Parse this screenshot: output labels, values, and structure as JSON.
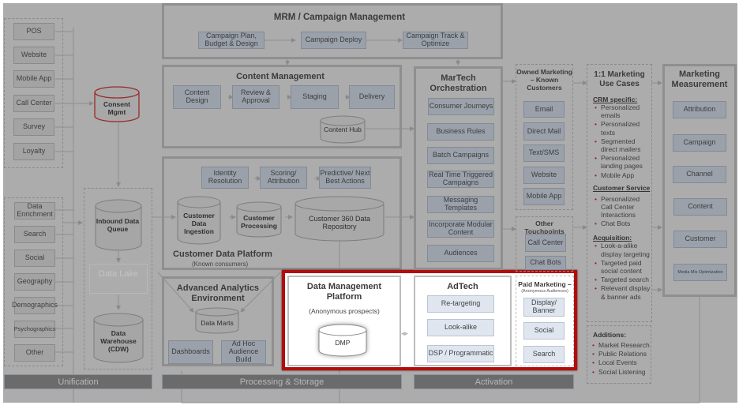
{
  "sources": {
    "first_party": [
      "POS",
      "Website",
      "Mobile App",
      "Call Center",
      "Survey",
      "Loyalty"
    ],
    "third_party": [
      "Data Enrichment",
      "Search",
      "Social",
      "Geography",
      "Demographics",
      "Psychographics",
      "Other"
    ]
  },
  "unification": {
    "consent": "Consent Mgmt",
    "inbound_queue": "Inbound Data Queue",
    "data_lake": "Data Lake",
    "warehouse": "Data Warehouse (CDW)",
    "band": "Unification"
  },
  "mrm": {
    "title": "MRM / Campaign Management",
    "steps": [
      "Campaign Plan, Budget & Design",
      "Campaign Deploy",
      "Campaign Track & Optimize"
    ]
  },
  "content_mgmt": {
    "title": "Content Management",
    "steps": [
      "Content Design",
      "Review & Approval",
      "Staging",
      "Delivery"
    ],
    "hub": "Content Hub"
  },
  "cdp": {
    "title": "Customer Data Platform",
    "subtitle": "(Known consumers)",
    "steps": [
      "Identity Resolution",
      "Scoring/ Attribution",
      "Predictive/ Next Best Actions"
    ],
    "ingestion": "Customer Data Ingestion",
    "processing": "Customer Processing",
    "repo": "Customer 360 Data Repository"
  },
  "analytics": {
    "title": "Advanced Analytics Environment",
    "marts": "Data Marts",
    "dashboards": "Dashboards",
    "adhoc": "Ad Hoc Audience Build"
  },
  "processing_band": "Processing & Storage",
  "dmp": {
    "title": "Data Management Platform",
    "subtitle": "(Anonymous prospects)",
    "db": "DMP"
  },
  "adtech": {
    "title": "AdTech",
    "items": [
      "Re-targeting",
      "Look-alike",
      "DSP / Programmatic"
    ]
  },
  "paid": {
    "title": "Paid Marketing –",
    "subtitle": "(Anonymous Audiences)",
    "items": [
      "Display/ Banner",
      "Social",
      "Search"
    ]
  },
  "martech": {
    "title": "MarTech Orchestration",
    "items": [
      "Consumer Journeys",
      "Business Rules",
      "Batch Campaigns",
      "Real Time Triggered Campaigns",
      "Messaging Templates",
      "Incorporate Modular Content",
      "Audiences"
    ]
  },
  "owned": {
    "title": "Owned Marketing – Known Customers",
    "items": [
      "Email",
      "Direct Mail",
      "Text/SMS",
      "Website",
      "Mobile App"
    ]
  },
  "other_touch": {
    "title": "Other Touchpoints",
    "items": [
      "Call Center",
      "Chat Bots"
    ]
  },
  "activation_band": "Activation",
  "use_cases": {
    "title": "1:1 Marketing Use Cases",
    "crm_head": "CRM specific:",
    "crm": [
      "Personalized emails",
      "Personalized texts",
      "Segmented direct mailers",
      "Personalized landing pages",
      "Mobile App"
    ],
    "cs_head": "Customer Service",
    "cs": [
      "Personalized Call Center Interactions",
      "Chat Bots"
    ],
    "acq_head": "Acquisition:",
    "acq": [
      "Look-a-alike display targeting",
      "Targeted paid social content",
      "Targeted search",
      "Relevant display & banner ads"
    ]
  },
  "additions": {
    "title": "Additions:",
    "items": [
      "Market Research",
      "Public Relations",
      "Local Events",
      "Social Listening"
    ]
  },
  "measurement": {
    "title": "Marketing Measurement",
    "items": [
      "Attribution",
      "Campaign",
      "Channel",
      "Content",
      "Customer",
      "Media Mix Optimization"
    ]
  },
  "colors": {
    "highlight": "#b00d0d",
    "consent_border": "#9b2a2a"
  }
}
